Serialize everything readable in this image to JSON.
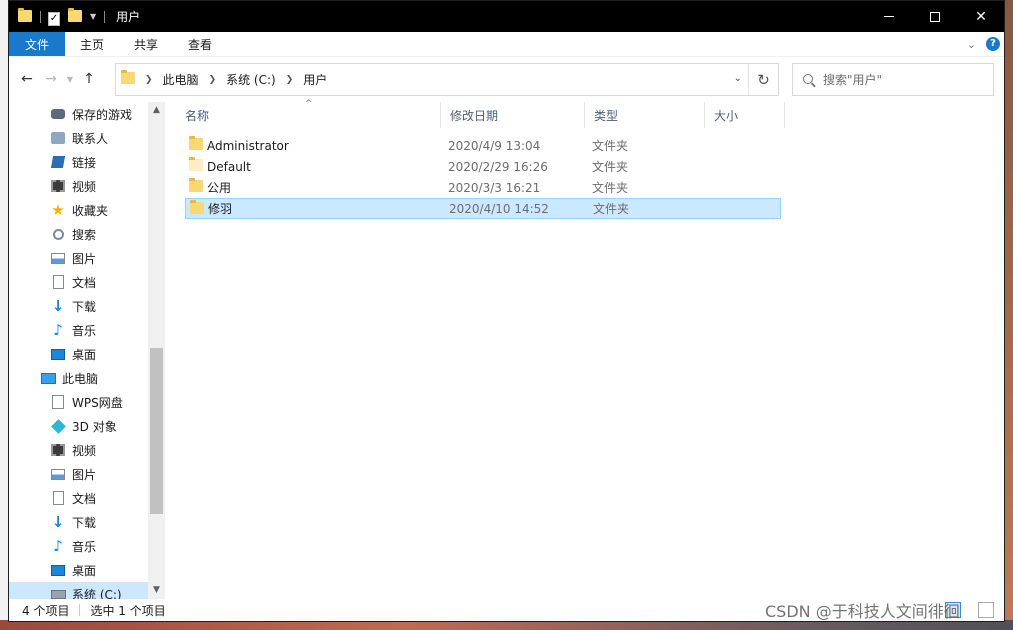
{
  "window": {
    "title": "用户"
  },
  "ribbon": {
    "tabs": [
      "文件",
      "主页",
      "共享",
      "查看"
    ]
  },
  "address": {
    "breadcrumbs": [
      "此电脑",
      "系统 (C:)",
      "用户"
    ]
  },
  "search": {
    "placeholder": "搜索\"用户\""
  },
  "nav_pane": {
    "items": [
      {
        "label": "保存的游戏",
        "icon": "saved-games-icon"
      },
      {
        "label": "联系人",
        "icon": "contacts-icon"
      },
      {
        "label": "链接",
        "icon": "links-icon"
      },
      {
        "label": "视频",
        "icon": "video-icon"
      },
      {
        "label": "收藏夹",
        "icon": "favorites-star-icon"
      },
      {
        "label": "搜索",
        "icon": "searches-icon"
      },
      {
        "label": "图片",
        "icon": "pictures-icon"
      },
      {
        "label": "文档",
        "icon": "documents-icon"
      },
      {
        "label": "下载",
        "icon": "downloads-icon"
      },
      {
        "label": "音乐",
        "icon": "music-icon"
      },
      {
        "label": "桌面",
        "icon": "desktop-icon"
      },
      {
        "label": "此电脑",
        "icon": "this-pc-icon"
      },
      {
        "label": "WPS网盘",
        "icon": "wps-cloud-icon"
      },
      {
        "label": "3D 对象",
        "icon": "3d-objects-icon"
      },
      {
        "label": "视频",
        "icon": "video-icon"
      },
      {
        "label": "图片",
        "icon": "pictures-icon"
      },
      {
        "label": "文档",
        "icon": "documents-icon"
      },
      {
        "label": "下载",
        "icon": "downloads-icon"
      },
      {
        "label": "音乐",
        "icon": "music-icon"
      },
      {
        "label": "桌面",
        "icon": "desktop-icon"
      },
      {
        "label": "系统 (C:)",
        "icon": "drive-icon"
      }
    ]
  },
  "columns": {
    "name": "名称",
    "modified": "修改日期",
    "type": "类型",
    "size": "大小"
  },
  "files": [
    {
      "name": "Administrator",
      "modified": "2020/4/9 13:04",
      "type": "文件夹"
    },
    {
      "name": "Default",
      "modified": "2020/2/29 16:26",
      "type": "文件夹"
    },
    {
      "name": "公用",
      "modified": "2020/3/3 16:21",
      "type": "文件夹"
    },
    {
      "name": "修羽",
      "modified": "2020/4/10 14:52",
      "type": "文件夹"
    }
  ],
  "status": {
    "count": "4 个项目",
    "selected": "选中 1 个项目"
  },
  "watermark": "CSDN @于科技人文间徘徊",
  "colors": {
    "file_tab": "#1979ca",
    "selection": "#cce8ff",
    "folder": "#f8d775"
  }
}
